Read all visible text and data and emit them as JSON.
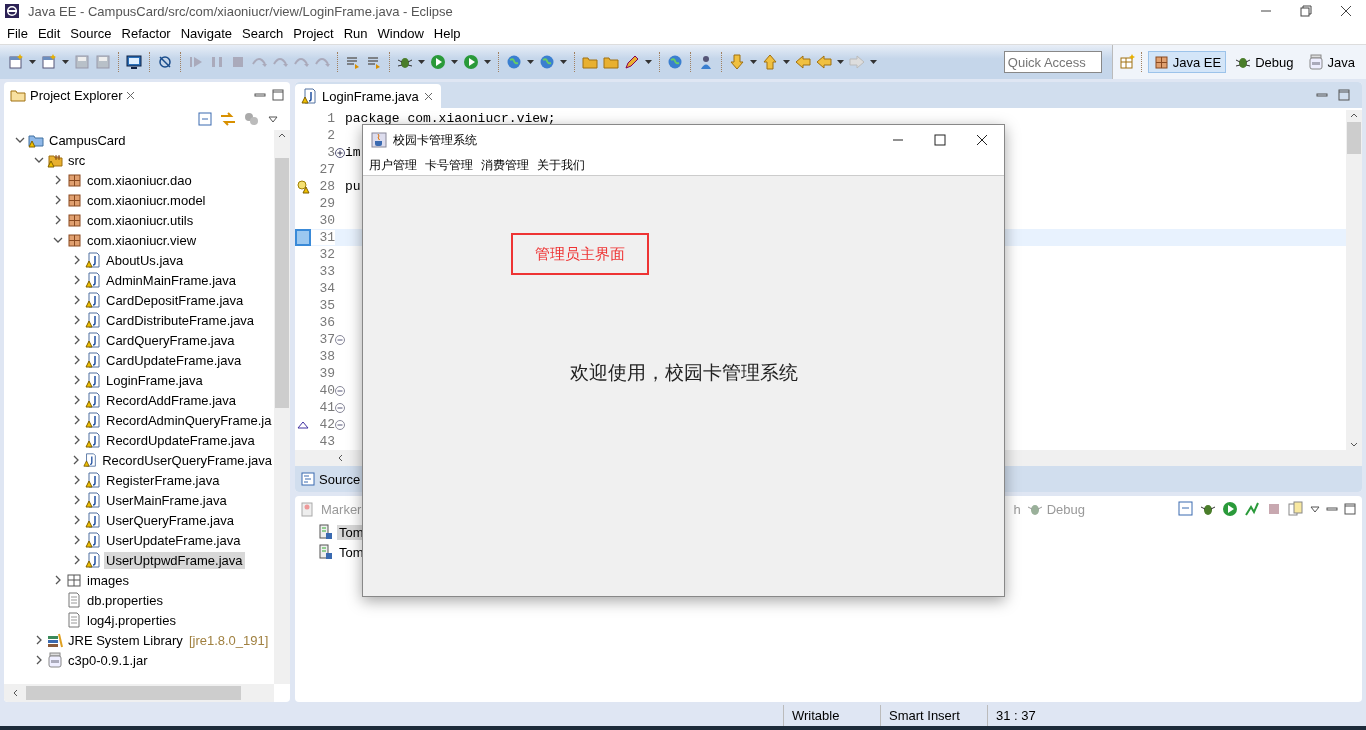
{
  "window": {
    "title": "Java EE - CampusCard/src/com/xiaoniucr/view/LoginFrame.java - Eclipse"
  },
  "menu": [
    "File",
    "Edit",
    "Source",
    "Refactor",
    "Navigate",
    "Search",
    "Project",
    "Run",
    "Window",
    "Help"
  ],
  "quick_access": {
    "placeholder": "Quick Access"
  },
  "perspectives": [
    {
      "label": "Java EE",
      "selected": true
    },
    {
      "label": "Debug",
      "selected": false
    },
    {
      "label": "Java",
      "selected": false
    }
  ],
  "explorer": {
    "title": "Project Explorer",
    "tree": [
      {
        "label": "CampusCard",
        "kind": "project",
        "expanded": true,
        "selected": false,
        "children": [
          {
            "label": "src",
            "kind": "source",
            "expanded": true,
            "selected": false,
            "children": [
              {
                "label": "com.xiaoniucr.dao",
                "kind": "package",
                "expanded": false,
                "selected": false
              },
              {
                "label": "com.xiaoniucr.model",
                "kind": "package",
                "expanded": false,
                "selected": false
              },
              {
                "label": "com.xiaoniucr.utils",
                "kind": "package",
                "expanded": false,
                "selected": false
              },
              {
                "label": "com.xiaoniucr.view",
                "kind": "package",
                "expanded": true,
                "selected": false,
                "children": [
                  {
                    "label": "AboutUs.java",
                    "kind": "java",
                    "expanded": false,
                    "selected": false
                  },
                  {
                    "label": "AdminMainFrame.java",
                    "kind": "java",
                    "expanded": false,
                    "selected": false
                  },
                  {
                    "label": "CardDepositFrame.java",
                    "kind": "java",
                    "expanded": false,
                    "selected": false
                  },
                  {
                    "label": "CardDistributeFrame.java",
                    "kind": "java",
                    "expanded": false,
                    "selected": false
                  },
                  {
                    "label": "CardQueryFrame.java",
                    "kind": "java",
                    "expanded": false,
                    "selected": false
                  },
                  {
                    "label": "CardUpdateFrame.java",
                    "kind": "java",
                    "expanded": false,
                    "selected": false
                  },
                  {
                    "label": "LoginFrame.java",
                    "kind": "java",
                    "expanded": false,
                    "selected": false
                  },
                  {
                    "label": "RecordAddFrame.java",
                    "kind": "java",
                    "expanded": false,
                    "selected": false
                  },
                  {
                    "label": "RecordAdminQueryFrame.ja",
                    "kind": "java",
                    "expanded": false,
                    "selected": false
                  },
                  {
                    "label": "RecordUpdateFrame.java",
                    "kind": "java",
                    "expanded": false,
                    "selected": false
                  },
                  {
                    "label": "RecordUserQueryFrame.java",
                    "kind": "java",
                    "expanded": false,
                    "selected": false
                  },
                  {
                    "label": "RegisterFrame.java",
                    "kind": "java",
                    "expanded": false,
                    "selected": false
                  },
                  {
                    "label": "UserMainFrame.java",
                    "kind": "java",
                    "expanded": false,
                    "selected": false
                  },
                  {
                    "label": "UserQueryFrame.java",
                    "kind": "java",
                    "expanded": false,
                    "selected": false
                  },
                  {
                    "label": "UserUpdateFrame.java",
                    "kind": "java",
                    "expanded": false,
                    "selected": false
                  },
                  {
                    "label": "UserUptpwdFrame.java",
                    "kind": "java",
                    "expanded": false,
                    "selected": true
                  }
                ]
              },
              {
                "label": "images",
                "kind": "folder",
                "expanded": false,
                "selected": false
              },
              {
                "label": "db.properties",
                "kind": "file",
                "selected": false
              },
              {
                "label": "log4j.properties",
                "kind": "file",
                "selected": false
              }
            ]
          },
          {
            "label": "JRE System Library",
            "decoration": "[jre1.8.0_191]",
            "kind": "library",
            "expanded": false,
            "selected": false
          },
          {
            "label": "c3p0-0.9.1.jar",
            "kind": "jar",
            "expanded": false,
            "selected": false
          }
        ]
      }
    ]
  },
  "editor": {
    "tab": "LoginFrame.java",
    "bottom_tab": "Source",
    "lines": [
      {
        "number": "1",
        "text": "package com.xiaoniucr.view;",
        "current": false
      },
      {
        "number": "2",
        "current": false
      },
      {
        "number": "3",
        "text": "im",
        "folded": true,
        "current": false
      },
      {
        "number": "27",
        "current": false
      },
      {
        "number": "28",
        "text": "pu",
        "warning": true,
        "current": false
      },
      {
        "number": "29",
        "current": false
      },
      {
        "number": "30",
        "current": false
      },
      {
        "number": "31",
        "annotated": true,
        "current": true
      },
      {
        "number": "32",
        "current": false
      },
      {
        "number": "33",
        "current": false
      },
      {
        "number": "34",
        "current": false
      },
      {
        "number": "35",
        "current": false
      },
      {
        "number": "36",
        "current": false
      },
      {
        "number": "37",
        "folded": false,
        "current": false
      },
      {
        "number": "38",
        "current": false
      },
      {
        "number": "39",
        "current": false
      },
      {
        "number": "40",
        "folded": false,
        "current": false
      },
      {
        "number": "41",
        "folded": false,
        "current": false
      },
      {
        "number": "42",
        "folded": false,
        "overrides": true,
        "current": false
      },
      {
        "number": "43",
        "current": false
      }
    ]
  },
  "bottom_panel": {
    "tabs": [
      {
        "label": "Marker",
        "selected": false
      },
      {
        "label": "h",
        "selected": false
      },
      {
        "label": "Debug",
        "selected": false
      }
    ],
    "rows": [
      {
        "label": "Tom",
        "selected": true
      },
      {
        "label": "Tom",
        "selected": false
      }
    ]
  },
  "status_bar": [
    "Writable",
    "Smart Insert",
    "31 : 37"
  ],
  "app_window": {
    "title": "校园卡管理系统",
    "menu": [
      "用户管理",
      "卡号管理",
      "消费管理",
      "关于我们"
    ],
    "heading": "管理员主界面",
    "welcome": "欢迎使用，校园卡管理系统"
  }
}
